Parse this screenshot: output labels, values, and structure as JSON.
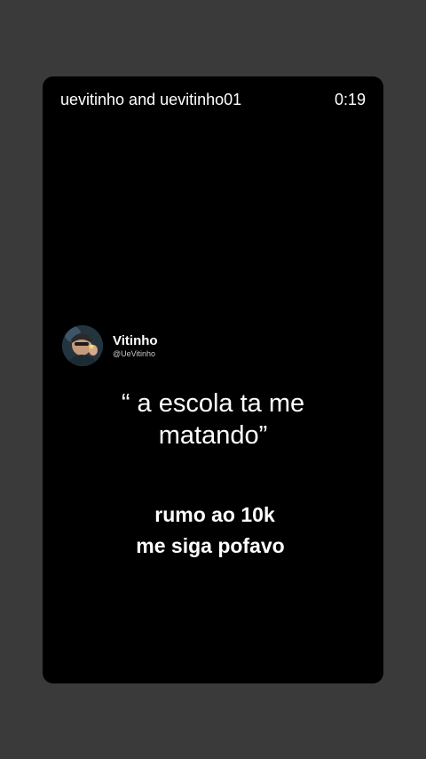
{
  "header": {
    "authors": "uevitinho and uevitinho01",
    "timer": "0:19"
  },
  "tweet": {
    "display_name": "Vitinho",
    "handle": "@UeVitinho",
    "quote_line1": "“ a escola ta me",
    "quote_line2": "matando”"
  },
  "caption": {
    "line1": "rumo ao 10k",
    "line2": "me siga pofavo"
  },
  "colors": {
    "page_background": "#3a3a3a",
    "video_background": "#000000",
    "text": "#ffffff"
  },
  "icons": {
    "avatar": "profile-photo-icon"
  }
}
